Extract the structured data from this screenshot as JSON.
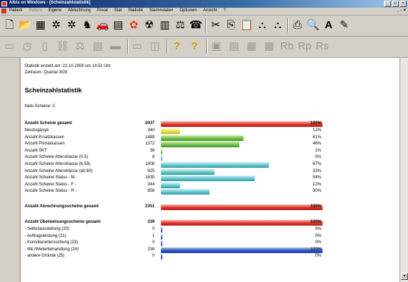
{
  "window": {
    "title": "Albis on Windows - [Scheinzahlstatistik]"
  },
  "menu": [
    "Patient",
    "Patient",
    "Eigene",
    "Abrechnung",
    "Privat",
    "Stat",
    "Statistik",
    "Stammdaten",
    "Optionen",
    "Ansicht",
    "?"
  ],
  "menu_disabled_index": 1,
  "toolbar1_icons": [
    "new-document-icon",
    "open-folder-icon",
    "grid-icon",
    "puzzle-icon",
    "puzzle2-icon",
    "person-icon",
    "car-icon",
    "calendar-icon",
    "flower-icon",
    "radiation-icon",
    "notepad-icon",
    "scale-icon",
    "phone-icon",
    "cut-icon",
    "copy-icon",
    "paste-icon",
    "binoculars-icon",
    "binoculars2-icon",
    "print-icon",
    "print-preview-icon",
    "font-icon",
    "highlight-icon"
  ],
  "toolbar2_icons": [
    "form-icon",
    "clock-icon",
    "book-icon",
    "link-icon",
    "scale2-icon",
    "table-icon",
    "bed-icon",
    "rect-icon",
    "split-icon",
    "help-icon",
    "help2-icon",
    "save-icon",
    "doc-icon",
    "grid2-icon",
    "grid3-icon",
    "rb-icon",
    "rp-icon",
    "rrs-icon"
  ],
  "report": {
    "created": "Statistik erstellt am: 22.10.2009 um 14:51 Uhr",
    "period": "Zeitraum: Quartal 3/09",
    "heading": "Scheinzahlstatistik",
    "non_scheine": "Nein-Scheine: 0"
  },
  "colors": {
    "red": "#e3362c",
    "yellow": "#e8e14a",
    "green": "#6fbf46",
    "teal": "#5ec5cc",
    "blue": "#2f56c8"
  },
  "chart_data": {
    "type": "table",
    "rows": [
      {
        "label": "Anzahl Scheine gesamt",
        "value": "2037",
        "percent": "100%",
        "fraction": 1.0,
        "color": "red",
        "bold": true
      },
      {
        "label": "Neuzugänge",
        "value": "340",
        "percent": "12%",
        "fraction": 0.12,
        "color": "yellow",
        "bold": false
      },
      {
        "label": "Anzahl Ersatzkassen",
        "value": "1489",
        "percent": "61%",
        "fraction": 0.51,
        "color": "green",
        "bold": false
      },
      {
        "label": "Anzahl Primärkassen",
        "value": "1372",
        "percent": "46%",
        "fraction": 0.485,
        "color": "green",
        "bold": false
      },
      {
        "label": "Anzahl SKT",
        "value": "38",
        "percent": "1%",
        "fraction": 0.01,
        "color": "green",
        "bold": false
      },
      {
        "label": "Anzahl Scheine Altersklasse (0-5)",
        "value": "8",
        "percent": "0%",
        "fraction": 0.005,
        "color": "teal",
        "bold": false
      },
      {
        "label": "Anzahl Scheine Altersklasse (6-59)",
        "value": "1908",
        "percent": "67%",
        "fraction": 0.67,
        "color": "teal",
        "bold": false
      },
      {
        "label": "Anzahl Scheine Altersklasse (ab 60)",
        "value": "925",
        "percent": "33%",
        "fraction": 0.33,
        "color": "teal",
        "bold": false
      },
      {
        "label": "Anzahl Scheine Status - M -",
        "value": "1635",
        "percent": "58%",
        "fraction": 0.58,
        "color": "teal",
        "bold": false
      },
      {
        "label": "Anzahl Scheine Status - F -",
        "value": "344",
        "percent": "12%",
        "fraction": 0.12,
        "color": "teal",
        "bold": false
      },
      {
        "label": "Anzahl Scheine Status - R -",
        "value": "858",
        "percent": "30%",
        "fraction": 0.3,
        "color": "teal",
        "bold": false
      },
      {
        "gap": true
      },
      {
        "label": "Anzahl Abrechnungsscheine gesamt",
        "value": "2351",
        "percent": "100%",
        "fraction": 1.0,
        "color": "red",
        "bold": true
      },
      {
        "gap": true
      },
      {
        "label": "Anzahl Überweisungsscheine gesamt",
        "value": "239",
        "percent": "100%",
        "fraction": 1.0,
        "color": "red",
        "bold": true
      },
      {
        "label": "- Selbstausstellung (20)",
        "value": "0",
        "percent": "0%",
        "fraction": 0.004,
        "color": "blue",
        "bold": false
      },
      {
        "label": "- Auftragsleistung (21)",
        "value": "1",
        "percent": "0%",
        "fraction": 0.004,
        "color": "blue",
        "bold": false
      },
      {
        "label": "- Konsiliaruntersuchung (23)",
        "value": "0",
        "percent": "0%",
        "fraction": 0.004,
        "color": "blue",
        "bold": false
      },
      {
        "label": "- Mit-/Weiterbehandlung (24)",
        "value": "238",
        "percent": "100%",
        "fraction": 1.0,
        "color": "blue",
        "bold": false
      },
      {
        "label": "- andere Gründe (25)",
        "value": "0",
        "percent": "0%",
        "fraction": 0.004,
        "color": "blue",
        "bold": false
      }
    ]
  }
}
